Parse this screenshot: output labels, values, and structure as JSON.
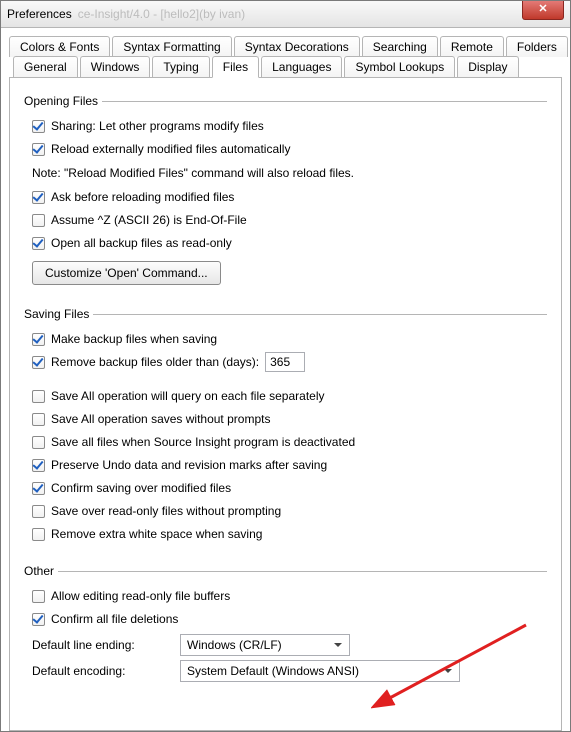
{
  "window": {
    "title": "Preferences",
    "subtitle": "ce-Insight/4.0 - [hello2](by ivan)"
  },
  "tabs_row1": [
    "Colors & Fonts",
    "Syntax Formatting",
    "Syntax Decorations",
    "Searching",
    "Remote",
    "Folders"
  ],
  "tabs_row2": [
    "General",
    "Windows",
    "Typing",
    "Files",
    "Languages",
    "Symbol Lookups",
    "Display"
  ],
  "active_tab": "Files",
  "groups": {
    "opening": {
      "legend": "Opening Files",
      "sharing": "Sharing: Let other programs modify files",
      "reload": "Reload externally modified files automatically",
      "note": "Note: \"Reload Modified Files\" command will also reload files.",
      "ask": "Ask before reloading modified files",
      "assume": "Assume ^Z (ASCII 26) is End-Of-File",
      "openbk": "Open all backup files as read-only",
      "customize_btn": "Customize 'Open' Command..."
    },
    "saving": {
      "legend": "Saving Files",
      "makebk": "Make backup files when saving",
      "removebk": "Remove backup files older than (days):",
      "removebk_days": "365",
      "saveall_query": "Save All operation will query on each file separately",
      "saveall_silent": "Save All operation saves without prompts",
      "save_deact": "Save all files when Source Insight program is deactivated",
      "preserve_undo": "Preserve Undo data and revision marks after saving",
      "confirm_over": "Confirm saving over modified files",
      "save_over_ro": "Save over read-only files without prompting",
      "remove_ws": "Remove extra white space when saving"
    },
    "other": {
      "legend": "Other",
      "allow_ro": "Allow editing read-only file buffers",
      "confirm_del": "Confirm all file deletions",
      "line_ending_label": "Default line ending:",
      "line_ending_value": "Windows (CR/LF)",
      "encoding_label": "Default encoding:",
      "encoding_value": "System Default (Windows ANSI)"
    }
  }
}
